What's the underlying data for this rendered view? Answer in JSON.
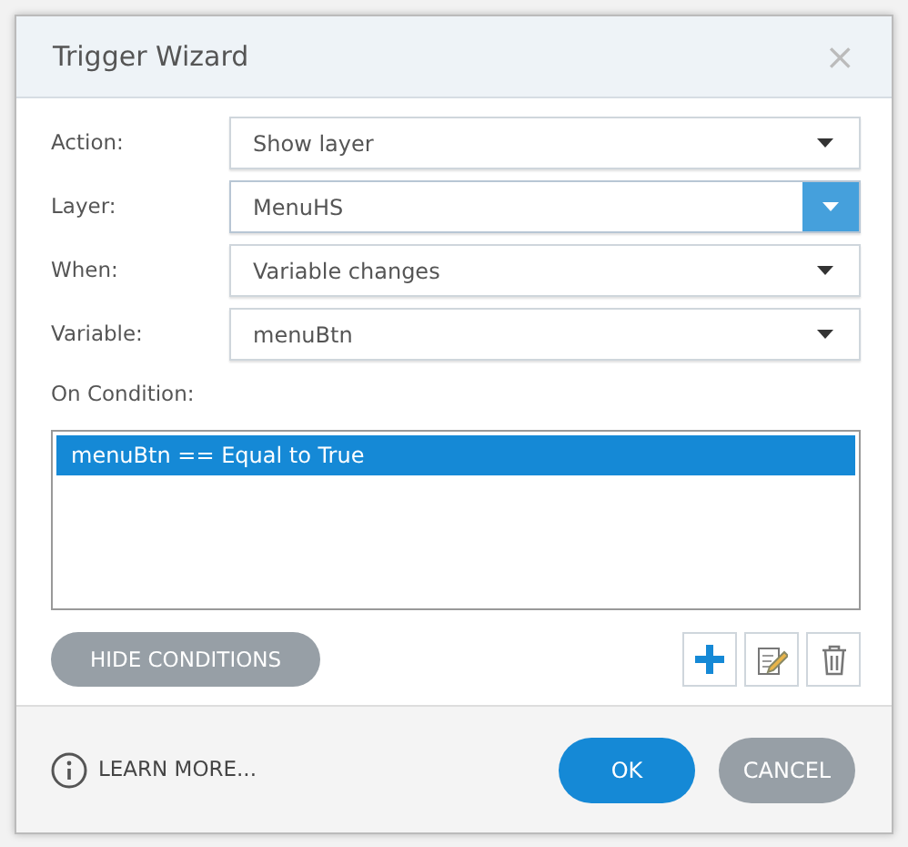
{
  "window": {
    "title": "Trigger Wizard",
    "close": "×"
  },
  "fields": [
    {
      "label": "Action:",
      "value": "Show layer",
      "focused": false
    },
    {
      "label": "Layer:",
      "value": "MenuHS",
      "focused": true
    },
    {
      "label": "When:",
      "value": "Variable changes",
      "focused": false
    },
    {
      "label": "Variable:",
      "value": "menuBtn",
      "focused": false
    }
  ],
  "conditions": {
    "label": "On Condition:",
    "items": [
      {
        "text": "menuBtn == Equal to True",
        "selected": true
      }
    ]
  },
  "hide_conditions_button": "HIDE CONDITIONS",
  "footer": {
    "learn_more": "LEARN MORE...",
    "ok": "OK",
    "cancel": "CANCEL"
  }
}
